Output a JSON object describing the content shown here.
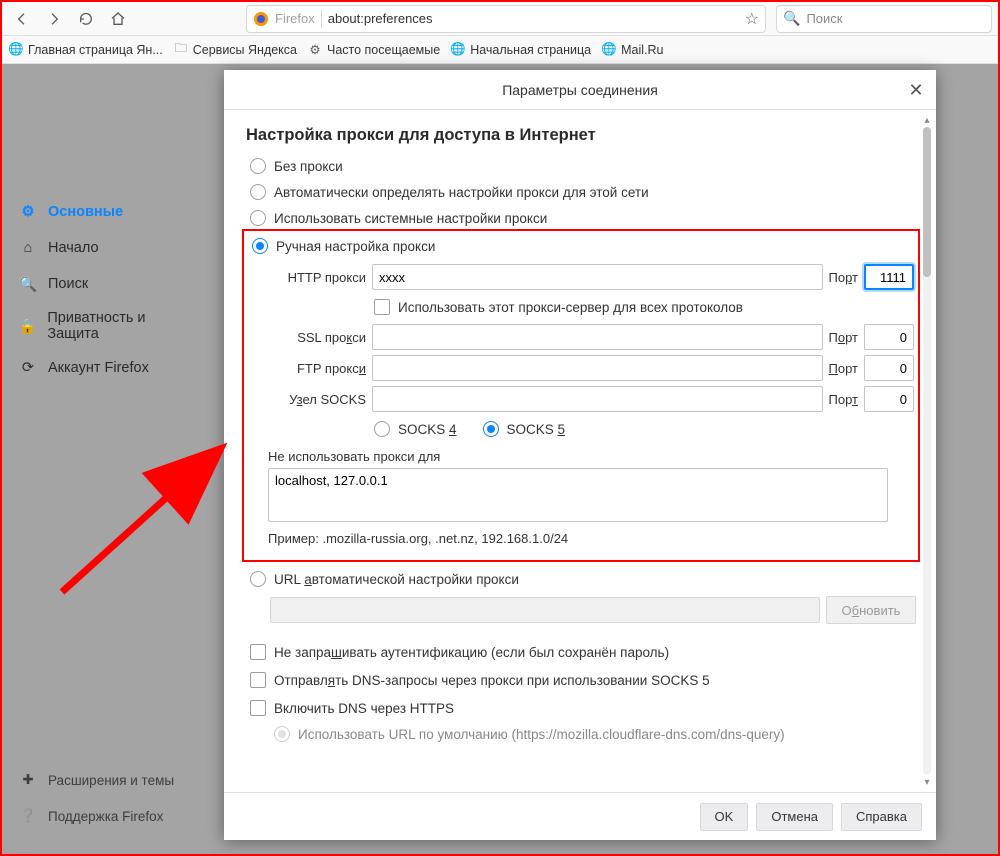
{
  "toolbar": {
    "firefox_label": "Firefox",
    "url": "about:preferences",
    "search_placeholder": "Поиск"
  },
  "bookmarks": {
    "items": [
      {
        "label": "Главная страница Ян...",
        "icon": "globe"
      },
      {
        "label": "Сервисы Яндекса",
        "icon": "folder"
      },
      {
        "label": "Часто посещаемые",
        "icon": "gear"
      },
      {
        "label": "Начальная страница",
        "icon": "globe"
      },
      {
        "label": "Mail.Ru",
        "icon": "globe"
      }
    ]
  },
  "sidebar": {
    "items": [
      {
        "label": "Основные",
        "icon": "gear",
        "active": true
      },
      {
        "label": "Начало",
        "icon": "home"
      },
      {
        "label": "Поиск",
        "icon": "search"
      },
      {
        "label": "Приватность и Защита",
        "icon": "lock"
      },
      {
        "label": "Аккаунт Firefox",
        "icon": "sync"
      }
    ],
    "bottom": [
      {
        "label": "Расширения и темы",
        "icon": "puzzle"
      },
      {
        "label": "Поддержка Firefox",
        "icon": "help"
      }
    ]
  },
  "modal": {
    "title": "Параметры соединения",
    "heading": "Настройка прокси для доступа в Интернет",
    "radio_no_proxy": "Без прокси",
    "radio_auto_detect": "Автоматически определять настройки прокси для этой сети",
    "radio_system": "Использовать системные настройки прокси",
    "radio_manual": "Ручная настройка прокси",
    "http_label": "HTTP прокси",
    "http_value": "xxxx",
    "http_port_label": "Порт",
    "http_port_value": "1111",
    "use_for_all": "Использовать этот прокси-сервер для всех протоколов",
    "ssl_label": "SSL прокси",
    "ssl_value": "",
    "ssl_port_label": "Порт",
    "ssl_port_value": "0",
    "ftp_label": "FTP прокси",
    "ftp_value": "",
    "ftp_port_label": "Порт",
    "ftp_port_value": "0",
    "socks_label": "Узел SOCKS",
    "socks_value": "",
    "socks_port_label": "Порт",
    "socks_port_value": "0",
    "socks4": "SOCKS 4",
    "socks5": "SOCKS 5",
    "no_proxy_for": "Не использовать прокси для",
    "no_proxy_val": "localhost, 127.0.0.1",
    "example": "Пример: .mozilla-russia.org, .net.nz, 192.168.1.0/24",
    "radio_pac": "URL автоматической настройки прокси",
    "refresh": "Обновить",
    "check_noauth": "Не запрашивать аутентификацию (если был сохранён пароль)",
    "check_socks_dns": "Отправлять DNS-запросы через прокси при использовании SOCKS 5",
    "check_doh": "Включить DNS через HTTPS",
    "doh_default": "Использовать URL по умолчанию (https://mozilla.cloudflare-dns.com/dns-query)",
    "btn_ok": "OK",
    "btn_cancel": "Отмена",
    "btn_help": "Справка"
  }
}
